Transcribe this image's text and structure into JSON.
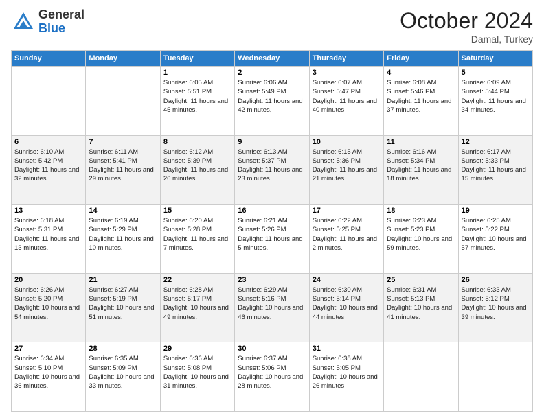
{
  "header": {
    "logo": {
      "general": "General",
      "blue": "Blue"
    },
    "title": "October 2024",
    "location": "Damal, Turkey"
  },
  "weekdays": [
    "Sunday",
    "Monday",
    "Tuesday",
    "Wednesday",
    "Thursday",
    "Friday",
    "Saturday"
  ],
  "weeks": [
    [
      {
        "day": "",
        "info": ""
      },
      {
        "day": "",
        "info": ""
      },
      {
        "day": "1",
        "info": "Sunrise: 6:05 AM\nSunset: 5:51 PM\nDaylight: 11 hours and 45 minutes."
      },
      {
        "day": "2",
        "info": "Sunrise: 6:06 AM\nSunset: 5:49 PM\nDaylight: 11 hours and 42 minutes."
      },
      {
        "day": "3",
        "info": "Sunrise: 6:07 AM\nSunset: 5:47 PM\nDaylight: 11 hours and 40 minutes."
      },
      {
        "day": "4",
        "info": "Sunrise: 6:08 AM\nSunset: 5:46 PM\nDaylight: 11 hours and 37 minutes."
      },
      {
        "day": "5",
        "info": "Sunrise: 6:09 AM\nSunset: 5:44 PM\nDaylight: 11 hours and 34 minutes."
      }
    ],
    [
      {
        "day": "6",
        "info": "Sunrise: 6:10 AM\nSunset: 5:42 PM\nDaylight: 11 hours and 32 minutes."
      },
      {
        "day": "7",
        "info": "Sunrise: 6:11 AM\nSunset: 5:41 PM\nDaylight: 11 hours and 29 minutes."
      },
      {
        "day": "8",
        "info": "Sunrise: 6:12 AM\nSunset: 5:39 PM\nDaylight: 11 hours and 26 minutes."
      },
      {
        "day": "9",
        "info": "Sunrise: 6:13 AM\nSunset: 5:37 PM\nDaylight: 11 hours and 23 minutes."
      },
      {
        "day": "10",
        "info": "Sunrise: 6:15 AM\nSunset: 5:36 PM\nDaylight: 11 hours and 21 minutes."
      },
      {
        "day": "11",
        "info": "Sunrise: 6:16 AM\nSunset: 5:34 PM\nDaylight: 11 hours and 18 minutes."
      },
      {
        "day": "12",
        "info": "Sunrise: 6:17 AM\nSunset: 5:33 PM\nDaylight: 11 hours and 15 minutes."
      }
    ],
    [
      {
        "day": "13",
        "info": "Sunrise: 6:18 AM\nSunset: 5:31 PM\nDaylight: 11 hours and 13 minutes."
      },
      {
        "day": "14",
        "info": "Sunrise: 6:19 AM\nSunset: 5:29 PM\nDaylight: 11 hours and 10 minutes."
      },
      {
        "day": "15",
        "info": "Sunrise: 6:20 AM\nSunset: 5:28 PM\nDaylight: 11 hours and 7 minutes."
      },
      {
        "day": "16",
        "info": "Sunrise: 6:21 AM\nSunset: 5:26 PM\nDaylight: 11 hours and 5 minutes."
      },
      {
        "day": "17",
        "info": "Sunrise: 6:22 AM\nSunset: 5:25 PM\nDaylight: 11 hours and 2 minutes."
      },
      {
        "day": "18",
        "info": "Sunrise: 6:23 AM\nSunset: 5:23 PM\nDaylight: 10 hours and 59 minutes."
      },
      {
        "day": "19",
        "info": "Sunrise: 6:25 AM\nSunset: 5:22 PM\nDaylight: 10 hours and 57 minutes."
      }
    ],
    [
      {
        "day": "20",
        "info": "Sunrise: 6:26 AM\nSunset: 5:20 PM\nDaylight: 10 hours and 54 minutes."
      },
      {
        "day": "21",
        "info": "Sunrise: 6:27 AM\nSunset: 5:19 PM\nDaylight: 10 hours and 51 minutes."
      },
      {
        "day": "22",
        "info": "Sunrise: 6:28 AM\nSunset: 5:17 PM\nDaylight: 10 hours and 49 minutes."
      },
      {
        "day": "23",
        "info": "Sunrise: 6:29 AM\nSunset: 5:16 PM\nDaylight: 10 hours and 46 minutes."
      },
      {
        "day": "24",
        "info": "Sunrise: 6:30 AM\nSunset: 5:14 PM\nDaylight: 10 hours and 44 minutes."
      },
      {
        "day": "25",
        "info": "Sunrise: 6:31 AM\nSunset: 5:13 PM\nDaylight: 10 hours and 41 minutes."
      },
      {
        "day": "26",
        "info": "Sunrise: 6:33 AM\nSunset: 5:12 PM\nDaylight: 10 hours and 39 minutes."
      }
    ],
    [
      {
        "day": "27",
        "info": "Sunrise: 6:34 AM\nSunset: 5:10 PM\nDaylight: 10 hours and 36 minutes."
      },
      {
        "day": "28",
        "info": "Sunrise: 6:35 AM\nSunset: 5:09 PM\nDaylight: 10 hours and 33 minutes."
      },
      {
        "day": "29",
        "info": "Sunrise: 6:36 AM\nSunset: 5:08 PM\nDaylight: 10 hours and 31 minutes."
      },
      {
        "day": "30",
        "info": "Sunrise: 6:37 AM\nSunset: 5:06 PM\nDaylight: 10 hours and 28 minutes."
      },
      {
        "day": "31",
        "info": "Sunrise: 6:38 AM\nSunset: 5:05 PM\nDaylight: 10 hours and 26 minutes."
      },
      {
        "day": "",
        "info": ""
      },
      {
        "day": "",
        "info": ""
      }
    ]
  ]
}
